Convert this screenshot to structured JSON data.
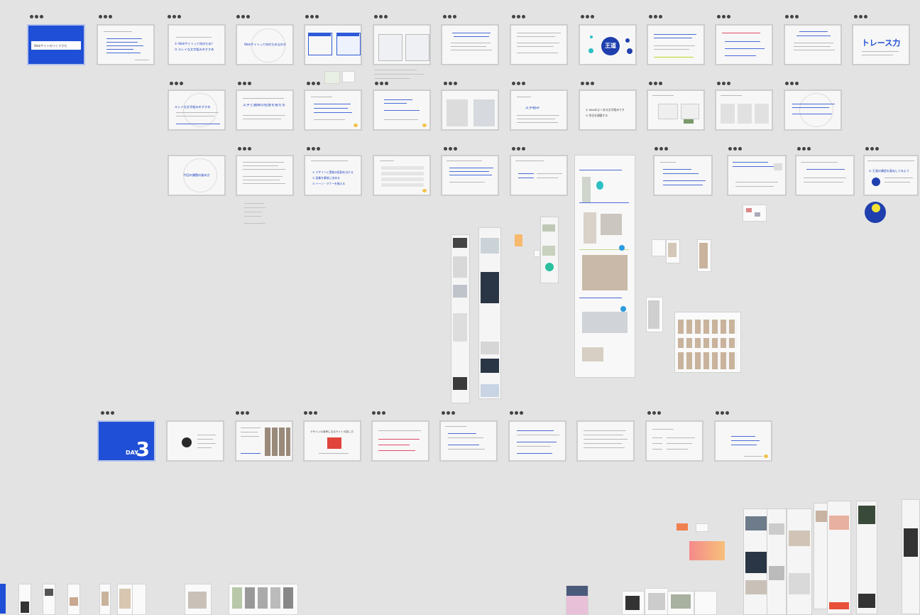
{
  "row1": {
    "slide1_title": "Webサイトのつくりかた",
    "slide3_line1": "① Webサイトって何のため？",
    "slide3_line2": "② キレイな文字組みのすすめ",
    "slide4_title": "Webサイトって何のためなのか",
    "slide9_brand": "王道",
    "slide13_title": "トレース力"
  },
  "row2": {
    "slide1_title": "キレイな文字組みのすすめ",
    "slide2_title": "文字と画像の密度を揃える",
    "slide7_line1": "① Webのよくある文字組みです",
    "slide7_line2": "② 余白を調整する"
  },
  "row3": {
    "slide1_title": "今回の課題の進め方",
    "slide3_line1": "① デザインと実装の役割を分ける",
    "slide3_line2": "② 画像を事前に決める",
    "slide3_line3": "③ トーン・マナーを揃える",
    "slide13_title": "① 王道の構造を真似してみよう"
  },
  "row4": {
    "day_label": "DAY",
    "day_number": "3",
    "slide5_title": "デザインの参考になるサイトの探し方"
  },
  "colors": {
    "canvas": "#e3e3e3",
    "brand_blue": "#1f4fd6",
    "accent_yellow": "#f2e234",
    "accent_orange": "#f6a24a",
    "accent_teal": "#2bbfc4"
  }
}
